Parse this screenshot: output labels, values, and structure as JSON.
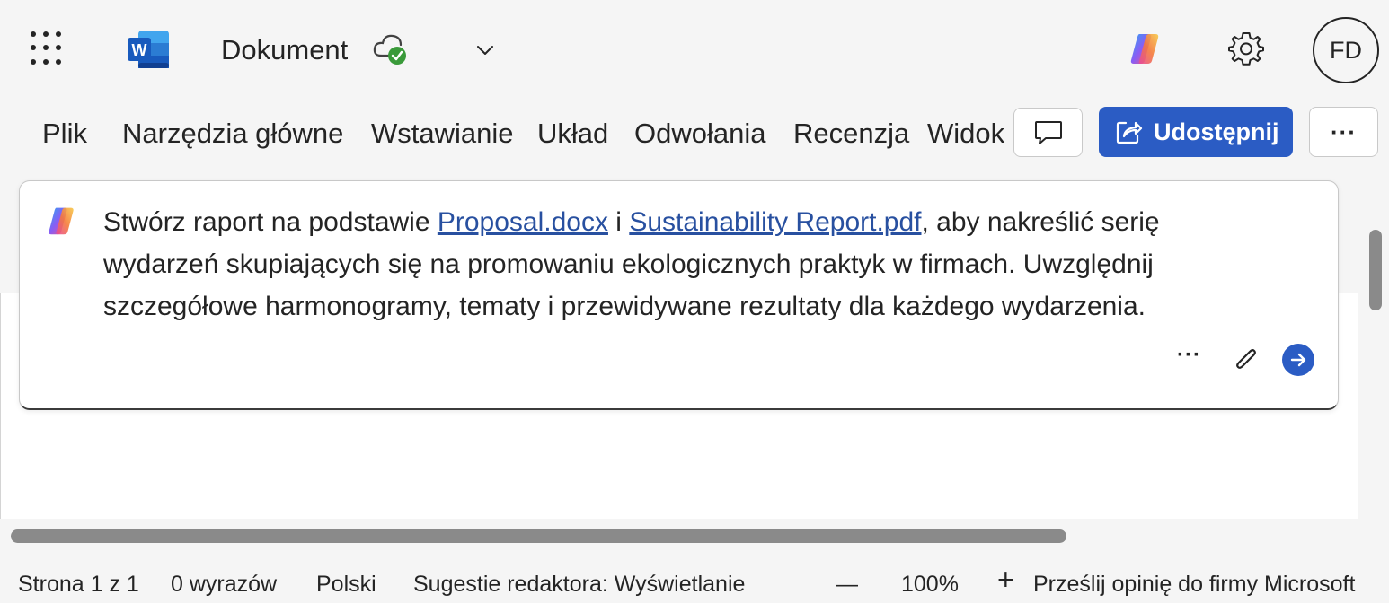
{
  "app": {
    "document_title": "Dokument",
    "user_initials": "FD",
    "brand_color": "#2b5cc4"
  },
  "icons": {
    "launcher": "app-launcher-icon",
    "word": "word-logo-icon",
    "cloud": "cloud-saved-icon",
    "chevron": "chevron-down-icon",
    "copilot": "copilot-icon",
    "settings": "gear-icon",
    "comment": "comment-icon",
    "share": "share-icon",
    "attach": "paperclip-icon",
    "send": "send-arrow-icon"
  },
  "ribbon": {
    "tabs": [
      "Plik",
      "Narzędzia główne",
      "Wstawianie",
      "Układ",
      "Odwołania",
      "Recenzja",
      "Widok"
    ],
    "share_label": "Udostępnij",
    "more_label": "···"
  },
  "prompt": {
    "text_before": "Stwórz raport na podstawie ",
    "file1": "Proposal.docx",
    "middle": " i ",
    "file2": "Sustainability Report.pdf",
    "text_after": ", aby nakreślić serię wydarzeń skupiających się na promowaniu ekologicznych praktyk w firmach. Uwzględnij szczegółowe harmonogramy, tematy i przewidywane rezultaty dla każdego wydarzenia.",
    "more_label": "···"
  },
  "statusbar": {
    "page": "Strona 1 z 1",
    "words": "0 wyrazów",
    "language": "Polski",
    "editor": "Sugestie redaktora: Wyświetlanie",
    "zoom_out": "—",
    "zoom": "100%",
    "zoom_in": "+",
    "feedback": "Prześlij opinię do firmy Microsoft"
  }
}
